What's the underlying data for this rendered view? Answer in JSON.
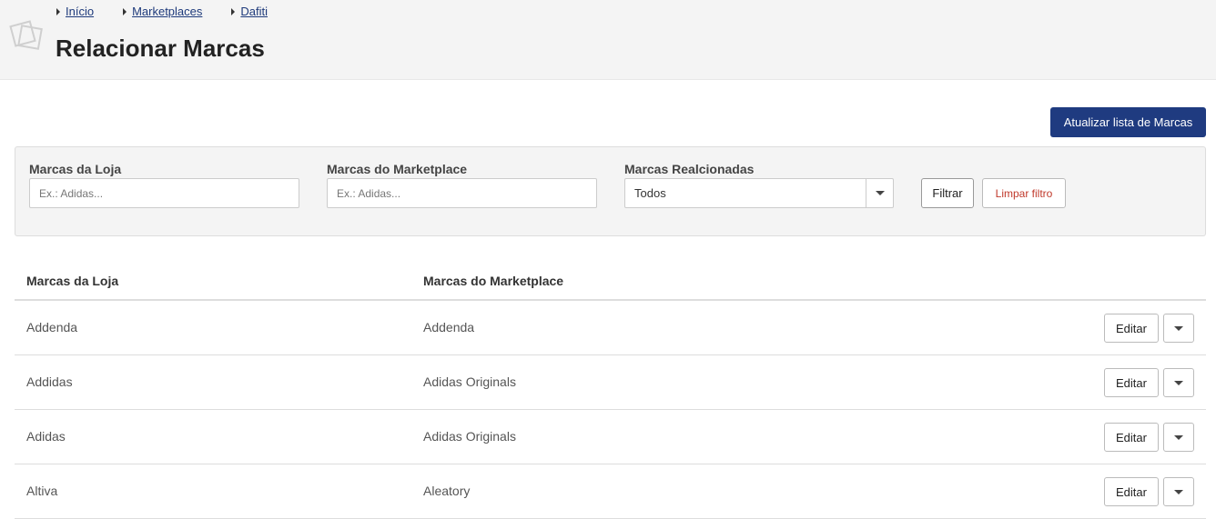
{
  "breadcrumb": [
    "Início",
    "Marketplaces",
    "Dafiti"
  ],
  "page_title": "Relacionar Marcas",
  "update_button": "Atualizar lista de Marcas",
  "filters": {
    "store_brand": {
      "label": "Marcas da Loja",
      "placeholder": "Ex.: Adidas..."
    },
    "marketplace_brand": {
      "label": "Marcas do Marketplace",
      "placeholder": "Ex.: Adidas..."
    },
    "related": {
      "label": "Marcas Realcionadas",
      "value": "Todos"
    },
    "filter_button": "Filtrar",
    "clear_button": "Limpar filtro"
  },
  "table": {
    "headers": [
      "Marcas da Loja",
      "Marcas do Marketplace"
    ],
    "rows": [
      {
        "store": "Addenda",
        "marketplace": "Addenda",
        "action": "Editar"
      },
      {
        "store": "Addidas",
        "marketplace": "Adidas Originals",
        "action": "Editar"
      },
      {
        "store": "Adidas",
        "marketplace": "Adidas Originals",
        "action": "Editar"
      },
      {
        "store": "Altiva",
        "marketplace": "Aleatory",
        "action": "Editar"
      }
    ]
  },
  "colors": {
    "primary": "#1f3b80",
    "danger_text": "#c0392b",
    "header_bg": "#f4f4f4"
  }
}
